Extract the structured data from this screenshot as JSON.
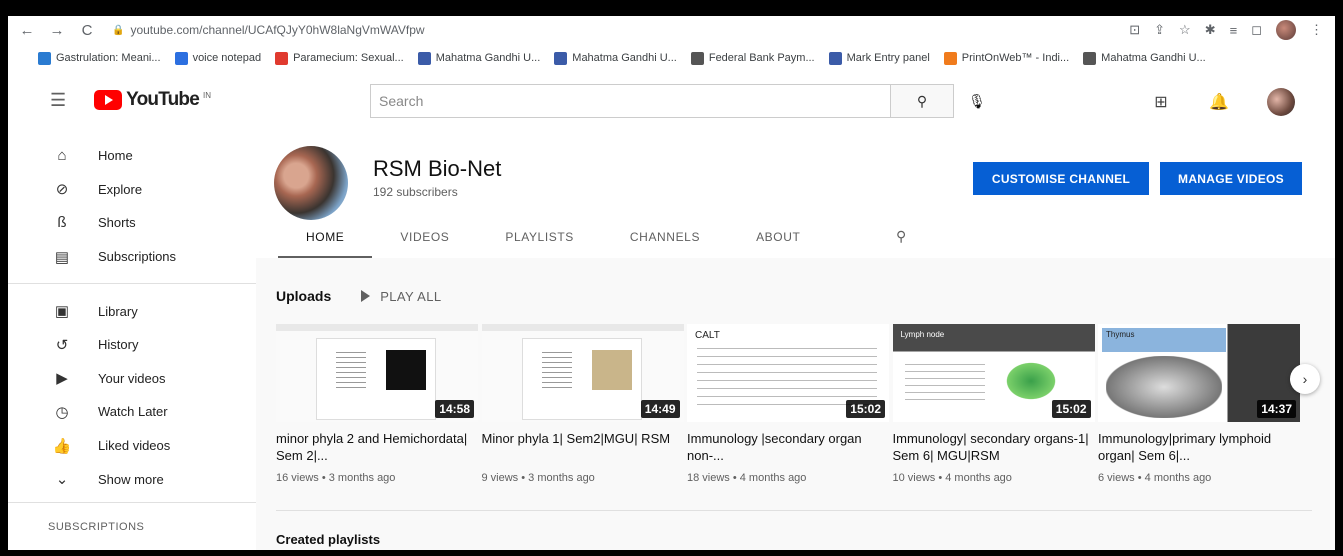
{
  "browser": {
    "url": "youtube.com/channel/UCAfQJyY0hW8laNgVmWAVfpw",
    "bookmarks": [
      {
        "label": "Gastrulation: Meani...",
        "color": "#2a7bd1"
      },
      {
        "label": "voice notepad",
        "color": "#2c6fe0"
      },
      {
        "label": "Paramecium: Sexual...",
        "color": "#e03a2f"
      },
      {
        "label": "Mahatma Gandhi U...",
        "color": "#3b5ba8"
      },
      {
        "label": "Mahatma Gandhi U...",
        "color": "#3b5ba8"
      },
      {
        "label": "Federal Bank Paym...",
        "color": "#555555"
      },
      {
        "label": "Mark Entry panel",
        "color": "#3b5ba8"
      },
      {
        "label": "PrintOnWeb™ - Indi...",
        "color": "#f07b1c"
      },
      {
        "label": "Mahatma Gandhi U...",
        "color": "#555555"
      }
    ]
  },
  "header": {
    "logo_text": "YouTube",
    "country": "IN",
    "search_placeholder": "Search"
  },
  "sidebar": {
    "items": [
      {
        "label": "Home",
        "icon": "home-icon",
        "glyph": "⌂"
      },
      {
        "label": "Explore",
        "icon": "compass-icon",
        "glyph": "⊘"
      },
      {
        "label": "Shorts",
        "icon": "shorts-icon",
        "glyph": "ß"
      },
      {
        "label": "Subscriptions",
        "icon": "subscriptions-icon",
        "glyph": "▤"
      }
    ],
    "items2": [
      {
        "label": "Library",
        "icon": "library-icon",
        "glyph": "▣"
      },
      {
        "label": "History",
        "icon": "history-icon",
        "glyph": "↺"
      },
      {
        "label": "Your videos",
        "icon": "your-videos-icon",
        "glyph": "▶"
      },
      {
        "label": "Watch Later",
        "icon": "watch-later-icon",
        "glyph": "◷"
      },
      {
        "label": "Liked videos",
        "icon": "thumbs-up-icon",
        "glyph": "👍"
      },
      {
        "label": "Show more",
        "icon": "chevron-down-icon",
        "glyph": "⌄"
      }
    ],
    "subscriptions_heading": "SUBSCRIPTIONS"
  },
  "channel": {
    "name": "RSM Bio-Net",
    "subscribers": "192 subscribers",
    "customise_label": "CUSTOMISE CHANNEL",
    "manage_label": "MANAGE VIDEOS",
    "tabs": [
      "HOME",
      "VIDEOS",
      "PLAYLISTS",
      "CHANNELS",
      "ABOUT"
    ],
    "active_tab": "HOME"
  },
  "uploads": {
    "label": "Uploads",
    "play_all": "PLAY ALL",
    "videos": [
      {
        "title": "minor phyla 2 and Hemichordata| Sem 2|...",
        "meta": "16 views • 3 months ago",
        "duration": "14:58",
        "thumb_text": ""
      },
      {
        "title": "Minor phyla 1| Sem2|MGU| RSM",
        "meta": "9 views • 3 months ago",
        "duration": "14:49",
        "thumb_text": ""
      },
      {
        "title": "Immunology |secondary organ non-...",
        "meta": "18 views • 4 months ago",
        "duration": "15:02",
        "thumb_text": "CALT"
      },
      {
        "title": "Immunology| secondary organs-1| Sem 6| MGU|RSM",
        "meta": "10 views • 4 months ago",
        "duration": "15:02",
        "thumb_text": "Lymph node"
      },
      {
        "title": "Immunology|primary lymphoid organ| Sem 6|...",
        "meta": "6 views • 4 months ago",
        "duration": "14:37",
        "thumb_text": "Thymus"
      }
    ]
  },
  "created_playlists": "Created playlists"
}
